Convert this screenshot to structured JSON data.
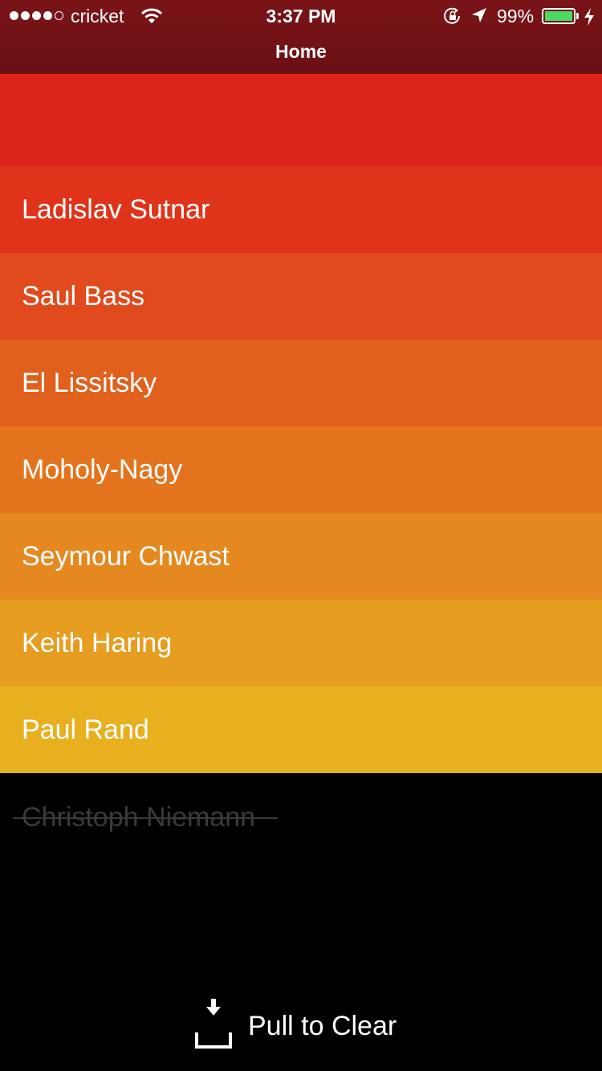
{
  "status_bar": {
    "carrier": "cricket",
    "time": "3:37 PM",
    "battery_percent": "99%",
    "battery_level": 0.99,
    "signal_bars_filled": 4,
    "signal_bars_total": 5
  },
  "header": {
    "title": "Home"
  },
  "list": {
    "new_item_color": "#dc241a",
    "items": [
      {
        "label": "Ladislav Sutnar",
        "color": "#df3419"
      },
      {
        "label": "Saul Bass",
        "color": "#e04a1c"
      },
      {
        "label": "El Lissitsky",
        "color": "#e0601c"
      },
      {
        "label": "Moholy-Nagy",
        "color": "#e3741d"
      },
      {
        "label": "Seymour Chwast",
        "color": "#e5881f"
      },
      {
        "label": "Keith Haring",
        "color": "#e69d20"
      },
      {
        "label": "Paul Rand",
        "color": "#e8b01f"
      }
    ],
    "completed": [
      {
        "label": "Christoph Niemann"
      }
    ]
  },
  "footer": {
    "pull_label": "Pull to Clear",
    "icon": "pull-down-tray-icon"
  },
  "colors": {
    "header_bg": "#6e1115",
    "battery_green": "#4cd964",
    "completed_text": "#3a3a3a",
    "background": "#000000"
  }
}
